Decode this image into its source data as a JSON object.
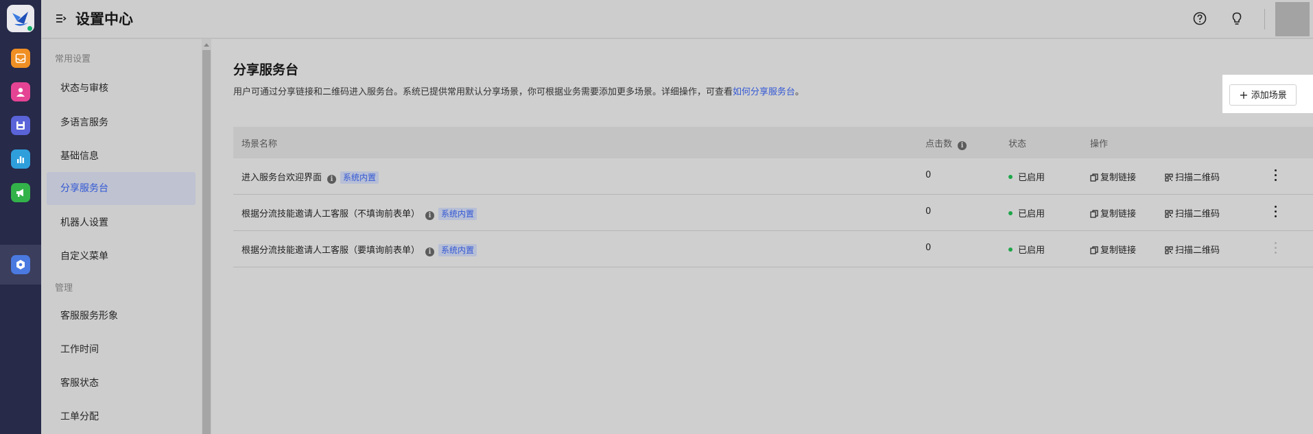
{
  "header": {
    "title": "设置中心"
  },
  "sidebar": {
    "groups": [
      {
        "label": "常用设置"
      },
      {
        "label": "管理"
      }
    ],
    "items": [
      {
        "label": "状态与审核"
      },
      {
        "label": "多语言服务"
      },
      {
        "label": "基础信息"
      },
      {
        "label": "分享服务台"
      },
      {
        "label": "机器人设置"
      },
      {
        "label": "自定义菜单"
      },
      {
        "label": "客服服务形象"
      },
      {
        "label": "工作时间"
      },
      {
        "label": "客服状态"
      },
      {
        "label": "工单分配"
      }
    ],
    "active_item": "分享服务台"
  },
  "rail": {
    "icons": [
      "inbox-icon",
      "contact-icon",
      "save-icon",
      "bar-chart-icon",
      "megaphone-icon",
      "settings-icon"
    ],
    "active_icon": "settings-icon",
    "colors": [
      "#f08f24",
      "#e54494",
      "#5a63d8",
      "#2f9fdc",
      "#33b24a",
      "#4a79e0"
    ]
  },
  "main": {
    "title": "分享服务台",
    "description": "用户可通过分享链接和二维码进入服务台。系统已提供常用默认分享场景，你可根据业务需要添加更多场景。详细操作，可查看",
    "description_link": "如何分享服务台",
    "description_end": "。",
    "add_button": "添加场景"
  },
  "table": {
    "columns": [
      "场景名称",
      "点击数",
      "状态",
      "操作"
    ],
    "rows": [
      {
        "name": "进入服务台欢迎界面",
        "badge": "系统内置",
        "clicks": "0",
        "status": "已启用",
        "copy_link": "复制链接",
        "scan_qr": "扫描二维码",
        "more_enabled": true
      },
      {
        "name": "根据分流技能邀请人工客服（不填询前表单）",
        "badge": "系统内置",
        "clicks": "0",
        "status": "已启用",
        "copy_link": "复制链接",
        "scan_qr": "扫描二维码",
        "more_enabled": true
      },
      {
        "name": "根据分流技能邀请人工客服（要填询前表单）",
        "badge": "系统内置",
        "clicks": "0",
        "status": "已启用",
        "copy_link": "复制链接",
        "scan_qr": "扫描二维码",
        "more_enabled": false
      }
    ]
  },
  "colors": {
    "accent": "#3358d4",
    "status_enabled": "#1ea64a",
    "rail_bg": "#272a49"
  }
}
